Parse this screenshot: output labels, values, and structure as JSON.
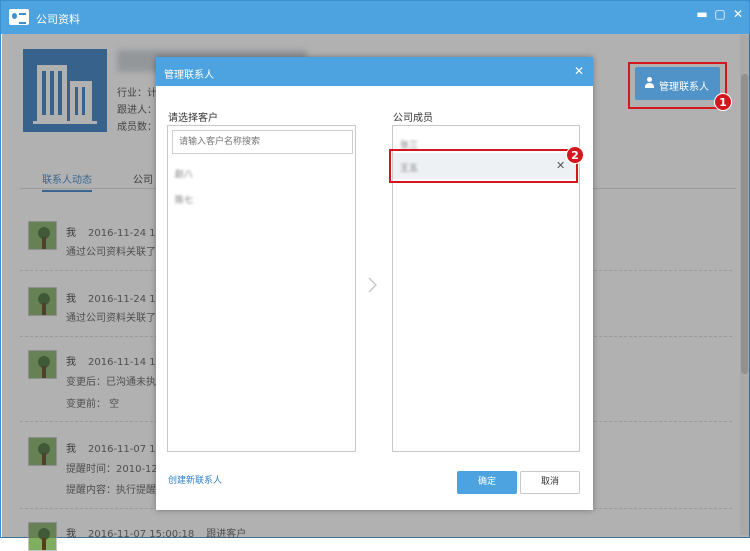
{
  "window": {
    "title": "公司资料"
  },
  "company": {
    "industry_label": "行业：计",
    "follower_label": "跟进人：",
    "members_label": "成员数：",
    "manage_button": "管理联系人"
  },
  "badges": {
    "one": "1",
    "two": "2"
  },
  "tabs": [
    "联系人动态",
    "公司"
  ],
  "feed": [
    {
      "who": "我",
      "time": "2016-11-24 14:0",
      "lines": [
        "通过公司资料关联了客"
      ]
    },
    {
      "who": "我",
      "time": "2016-11-24 14:0",
      "lines": [
        "通过公司资料关联了客"
      ]
    },
    {
      "who": "我",
      "time": "2016-11-14 14:5",
      "lines": [
        "变更后：已沟通未执行",
        "变更前： 空"
      ]
    },
    {
      "who": "我",
      "time": "2016-11-07 15:0",
      "lines": [
        "提醒时间：2010-12-0",
        "提醒内容：执行提醒确"
      ]
    },
    {
      "who": "我",
      "time": "2016-11-07 15:00:18",
      "lines": [
        "跟进客户"
      ]
    }
  ],
  "dialog": {
    "title": "管理联系人",
    "left_label": "请选择客户",
    "search_placeholder": "请输入客户名称搜索",
    "customers": [
      "赵八",
      "陈七"
    ],
    "right_label": "公司成员",
    "members": [
      "张三",
      "王五"
    ],
    "create_link": "创建新联系人",
    "ok": "确定",
    "cancel": "取消"
  }
}
